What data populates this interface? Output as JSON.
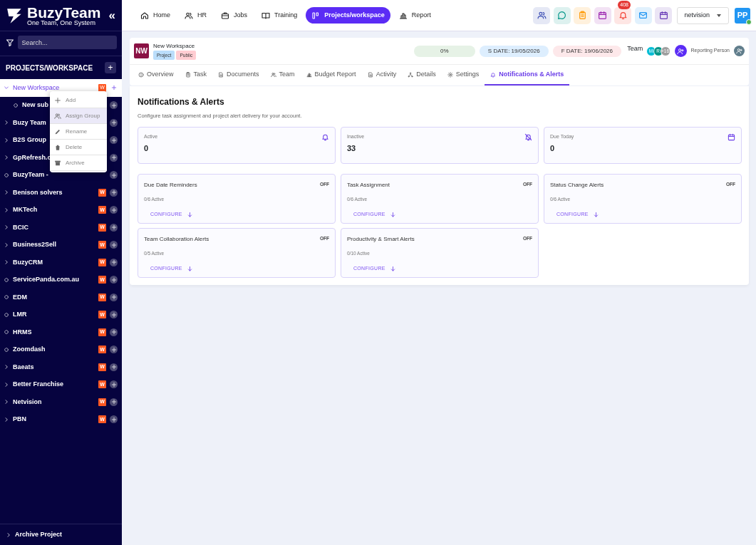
{
  "brand": {
    "name": "BuzyTeam",
    "tagline": "One Team, One System",
    "collapse": "«"
  },
  "sidebar": {
    "search": {
      "placeholder": "Search..."
    },
    "section_title": "PROJECTS/WORKSPACE",
    "add": "+",
    "items": [
      {
        "label": "New Workspace",
        "kind": "folder",
        "expanded": true,
        "selected": true,
        "badge": {
          "text": "W",
          "color": "#ff5722"
        },
        "children": [
          {
            "label": "New sub",
            "kind": "leaf",
            "selected": false
          }
        ]
      },
      {
        "label": "Buzy Team",
        "kind": "folder",
        "expanded": false,
        "selected": false
      },
      {
        "label": "B2S Group",
        "kind": "folder",
        "expanded": false,
        "selected": false
      },
      {
        "label": "GpRefresh.c",
        "kind": "folder",
        "expanded": false,
        "selected": false
      },
      {
        "label": "BuzyTeam -",
        "kind": "leaf",
        "selected": false
      },
      {
        "label": "Benison solvers",
        "kind": "folder",
        "expanded": false,
        "selected": false,
        "badge": {
          "text": "W",
          "color": "#ff5722"
        }
      },
      {
        "label": "MKTech",
        "kind": "folder",
        "expanded": false,
        "selected": false,
        "badge": {
          "text": "W",
          "color": "#ff5722"
        }
      },
      {
        "label": "BCIC",
        "kind": "folder",
        "expanded": false,
        "selected": false,
        "badge": {
          "text": "W",
          "color": "#ff5722"
        }
      },
      {
        "label": "Business2Sell",
        "kind": "folder",
        "expanded": false,
        "selected": false,
        "badge": {
          "text": "W",
          "color": "#ff5722"
        }
      },
      {
        "label": "BuzyCRM",
        "kind": "folder",
        "expanded": false,
        "selected": false,
        "badge": {
          "text": "W",
          "color": "#ff5722"
        }
      },
      {
        "label": "ServicePanda.com.au",
        "kind": "leaf",
        "selected": false,
        "badge": {
          "text": "W",
          "color": "#ff5722"
        }
      },
      {
        "label": "EDM",
        "kind": "leaf",
        "selected": false,
        "badge": {
          "text": "W",
          "color": "#ff5722"
        }
      },
      {
        "label": "LMR",
        "kind": "leaf",
        "selected": false,
        "badge": {
          "text": "W",
          "color": "#ff5722"
        }
      },
      {
        "label": "HRMS",
        "kind": "leaf",
        "selected": false,
        "badge": {
          "text": "W",
          "color": "#ff5722"
        }
      },
      {
        "label": "Zoomdash",
        "kind": "leaf",
        "selected": false,
        "badge": {
          "text": "W",
          "color": "#ff5722"
        }
      },
      {
        "label": "Baeats",
        "kind": "folder",
        "expanded": false,
        "selected": false,
        "badge": {
          "text": "W",
          "color": "#ff5722"
        }
      },
      {
        "label": "Better Franchise",
        "kind": "folder",
        "expanded": false,
        "selected": false,
        "badge": {
          "text": "W",
          "color": "#ff5722"
        }
      },
      {
        "label": "Netvision",
        "kind": "folder",
        "expanded": false,
        "selected": false,
        "badge": {
          "text": "W",
          "color": "#ff5722"
        }
      },
      {
        "label": "PBN",
        "kind": "folder",
        "expanded": false,
        "selected": false,
        "badge": {
          "text": "W",
          "color": "#ff5722"
        }
      }
    ],
    "context_menu": [
      {
        "label": "Add",
        "selected": false
      },
      {
        "label": "Assign Group",
        "selected": true
      },
      {
        "label": "Rename",
        "selected": false
      },
      {
        "label": "Delete",
        "selected": false
      },
      {
        "label": "Archive",
        "selected": false
      }
    ],
    "footer": "Archive Project"
  },
  "topnav": [
    {
      "label": "Home",
      "selected": false
    },
    {
      "label": "HR",
      "selected": false
    },
    {
      "label": "Jobs",
      "selected": false
    },
    {
      "label": "Training",
      "selected": false
    },
    {
      "label": "Projects/workspace",
      "selected": true
    },
    {
      "label": "Report",
      "selected": false
    }
  ],
  "notification_count": "408",
  "account_select": "netvision",
  "user_avatar": {
    "initials": "PP",
    "online": true
  },
  "project": {
    "initials": "NW",
    "name": "New Workspace",
    "tags": [
      {
        "label": "Project",
        "color": "#bbdefb"
      },
      {
        "label": "Public",
        "color": "#ffcdd2"
      }
    ],
    "progress": {
      "label": "0%",
      "level": 0
    },
    "start_date": "S DATE: 19/05/2026",
    "finish_date": "F DATE: 19/06/2026",
    "team_label": "Team",
    "team_avatars": [
      {
        "initials": "M",
        "color": "#00bcd4"
      },
      {
        "initials": "R",
        "color": "#009688"
      },
      {
        "initials": "+16",
        "color": "#9e9e9e"
      }
    ],
    "reporting_label": "Reporting Person"
  },
  "tabs": [
    {
      "label": "Overview",
      "selected": false
    },
    {
      "label": "Task",
      "selected": false
    },
    {
      "label": "Documents",
      "selected": false
    },
    {
      "label": "Team",
      "selected": false
    },
    {
      "label": "Budget Report",
      "selected": false
    },
    {
      "label": "Activity",
      "selected": false
    },
    {
      "label": "Details",
      "selected": false
    },
    {
      "label": "Settings",
      "selected": false
    },
    {
      "label": "Notifications & Alerts",
      "selected": true
    }
  ],
  "panel": {
    "title": "Notifications & Alerts",
    "subtitle": "Configure task assignment and project alert delivery for your account.",
    "stats": [
      {
        "label": "Active",
        "value": "0"
      },
      {
        "label": "Inactive",
        "value": "33"
      },
      {
        "label": "Due Today",
        "value": "0"
      }
    ],
    "groups": [
      {
        "title": "Due Date Reminders",
        "on": false,
        "status": "OFF",
        "count": "0/6 Active",
        "action": "CONFIGURE"
      },
      {
        "title": "Task Assignment",
        "on": false,
        "status": "OFF",
        "count": "0/6 Active",
        "action": "CONFIGURE"
      },
      {
        "title": "Status Change Alerts",
        "on": false,
        "status": "OFF",
        "count": "0/6 Active",
        "action": "CONFIGURE"
      },
      {
        "title": "Team Collaboration Alerts",
        "on": false,
        "status": "OFF",
        "count": "0/5 Active",
        "action": "CONFIGURE"
      },
      {
        "title": "Productivity & Smart Alerts",
        "on": false,
        "status": "OFF",
        "count": "0/10 Active",
        "action": "CONFIGURE"
      }
    ]
  }
}
